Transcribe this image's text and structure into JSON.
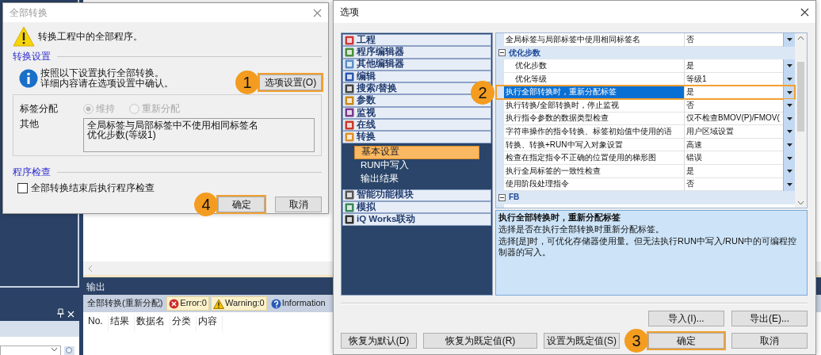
{
  "workspace": {
    "output": {
      "title": "输出",
      "tabs": [
        {
          "label": "全部转换(重新分配)",
          "kind": "label"
        },
        {
          "label": "Error:0",
          "kind": "error",
          "on": true
        },
        {
          "label": "Warning:0",
          "kind": "warning",
          "on": true
        },
        {
          "label": "Information",
          "kind": "info",
          "on": false
        }
      ],
      "columns": [
        "No.",
        "结果",
        "数据名",
        "分类",
        "内容"
      ]
    }
  },
  "convert_dialog": {
    "title": "全部转换",
    "message": "转换工程中的全部程序。",
    "settings_heading": "转换设置",
    "info_lines": [
      "按照以下设置执行全部转换。",
      "详细内容请在选项设置中确认。"
    ],
    "options_button": {
      "label": "选项设置(O)",
      "callout": "1"
    },
    "tag_label": "标签分配",
    "tag_options": [
      {
        "label": "维持",
        "selected": true,
        "disabled": true
      },
      {
        "label": "重新分配",
        "selected": false,
        "disabled": true
      }
    ],
    "other_label": "其他",
    "other_lines": [
      "全局标签与局部标签中不使用相同标签名",
      "优化步数(等级1)"
    ],
    "check_heading": "程序检查",
    "check_option": {
      "label": "全部转换结束后执行程序检查",
      "checked": false
    },
    "buttons": [
      {
        "label": "确定",
        "callout": "4"
      },
      {
        "label": "取消"
      }
    ]
  },
  "options_dialog": {
    "title": "选项",
    "categories": [
      {
        "label": "工程"
      },
      {
        "label": "程序编辑器"
      },
      {
        "label": "其他编辑器"
      },
      {
        "label": "编辑"
      },
      {
        "label": "搜索/替换"
      },
      {
        "label": "参数"
      },
      {
        "label": "监视"
      },
      {
        "label": "在线"
      },
      {
        "label": "转换",
        "children": [
          {
            "label": "基本设置",
            "selected": true
          },
          {
            "label": "RUN中写入",
            "selected": false
          },
          {
            "label": "输出结果",
            "selected": false
          }
        ]
      },
      {
        "label": "智能功能模块"
      },
      {
        "label": "模拟"
      },
      {
        "label": "iQ Works联动"
      }
    ],
    "properties": [
      {
        "kind": "row",
        "name": "全局标签与局部标签中使用相同标签名",
        "value": "否",
        "selected": false
      },
      {
        "kind": "group",
        "name": "优化步数",
        "expanded": true,
        "children": [
          {
            "kind": "row",
            "name": "优化步数",
            "value": "是",
            "selected": false
          },
          {
            "kind": "row",
            "name": "优化等级",
            "value": "等级1",
            "selected": false
          }
        ]
      },
      {
        "kind": "row",
        "name": "执行全部转换时，重新分配标签",
        "value": "是",
        "selected": true,
        "callout": "2"
      },
      {
        "kind": "row",
        "name": "执行转换/全部转换时，停止监视",
        "value": "否",
        "selected": false
      },
      {
        "kind": "row",
        "name": "执行指令参数的数据类型检查",
        "value": "仅不检查BMOV(P)/FMOV(",
        "selected": false
      },
      {
        "kind": "row",
        "name": "字符串操作的指令转换、标签初始值中使用的语",
        "value": "用户区域设置",
        "selected": false
      },
      {
        "kind": "row",
        "name": "转换、转换+RUN中写入对象设置",
        "value": "高速",
        "selected": false
      },
      {
        "kind": "row",
        "name": "检查在指定指令不正确的位置使用的梯形图",
        "value": "错误",
        "selected": false
      },
      {
        "kind": "row",
        "name": "执行全局标签的一致性检查",
        "value": "是",
        "selected": false
      },
      {
        "kind": "row",
        "name": "使用阶段处理指令",
        "value": "否",
        "selected": false
      },
      {
        "kind": "group",
        "name": "FB",
        "expanded": true
      }
    ],
    "description": {
      "title": "执行全部转换时，重新分配标签",
      "lines": [
        "选择是否在执行全部转换时重新分配标签。",
        "选择[是]时，可优化存储器使用量。但无法执行RUN中写入/RUN中的可编程控制器的写入。"
      ]
    },
    "import_button": {
      "label": "导入(I)..."
    },
    "export_button": {
      "label": "导出(E)..."
    },
    "footer_buttons": [
      {
        "label": "恢复为默认(D)"
      },
      {
        "label": "恢复为既定值(R)"
      },
      {
        "label": "设置为既定值(S)"
      },
      {
        "label": "确定",
        "callout": "3"
      },
      {
        "label": "取消"
      }
    ]
  }
}
